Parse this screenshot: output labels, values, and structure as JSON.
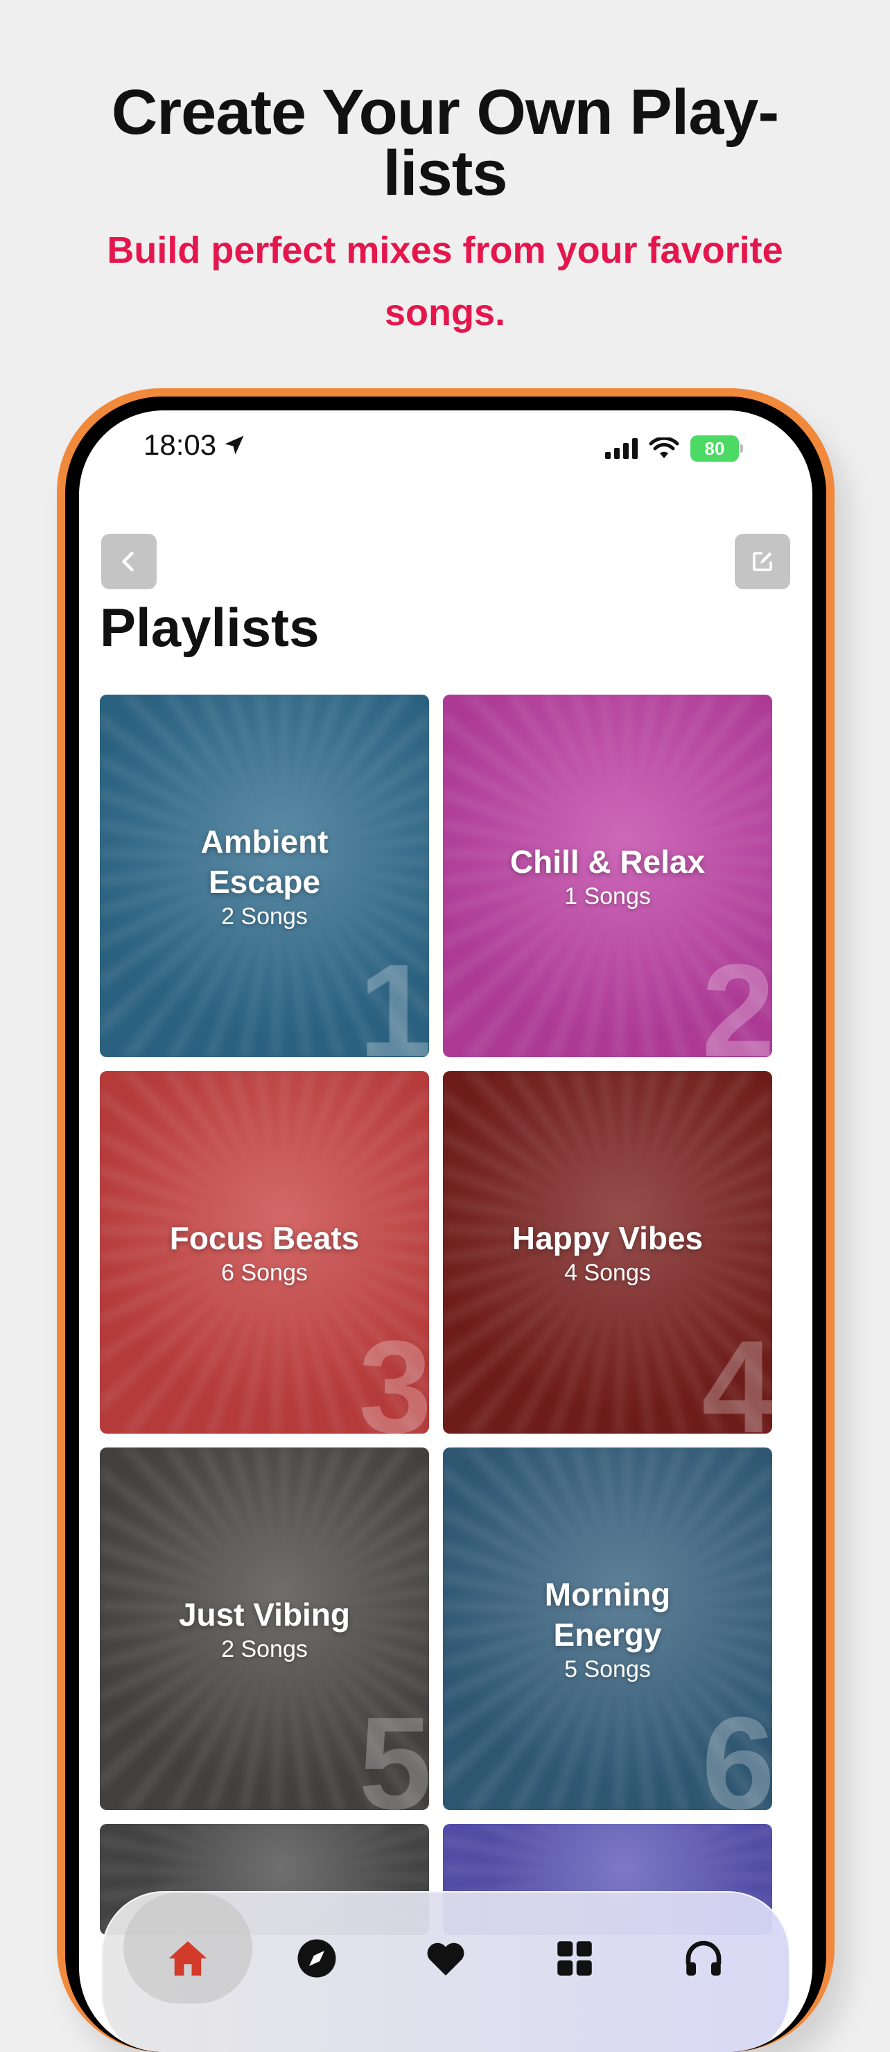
{
  "headline": "Create Your Own Play-lists",
  "subheadline": "Build perfect mixes from your favorite songs.",
  "status_bar": {
    "time": "18:03",
    "battery": "80"
  },
  "page_title": "Playlists",
  "colors": {
    "accent": "#e4164c",
    "frame": "#f1893d",
    "tab_active": "#d23a2a"
  },
  "playlists": [
    {
      "name": "Ambient Escape",
      "count": "2 Songs",
      "index": "1",
      "color": "#2f6c8e"
    },
    {
      "name": "Chill & Relax",
      "count": "1 Songs",
      "index": "2",
      "color": "#c041a6"
    },
    {
      "name": "Focus Beats",
      "count": "6 Songs",
      "index": "3",
      "color": "#c94040"
    },
    {
      "name": "Happy Vibes",
      "count": "4 Songs",
      "index": "4",
      "color": "#7a1f1c"
    },
    {
      "name": "Just Vibing",
      "count": "2 Songs",
      "index": "5",
      "color": "#4a4644"
    },
    {
      "name": "Morning Energy",
      "count": "5 Songs",
      "index": "6",
      "color": "#34607e"
    }
  ],
  "tabs": [
    {
      "icon": "home-icon",
      "active": true
    },
    {
      "icon": "compass-icon",
      "active": false
    },
    {
      "icon": "heart-icon",
      "active": false
    },
    {
      "icon": "grid-icon",
      "active": false
    },
    {
      "icon": "headphones-icon",
      "active": false
    }
  ]
}
